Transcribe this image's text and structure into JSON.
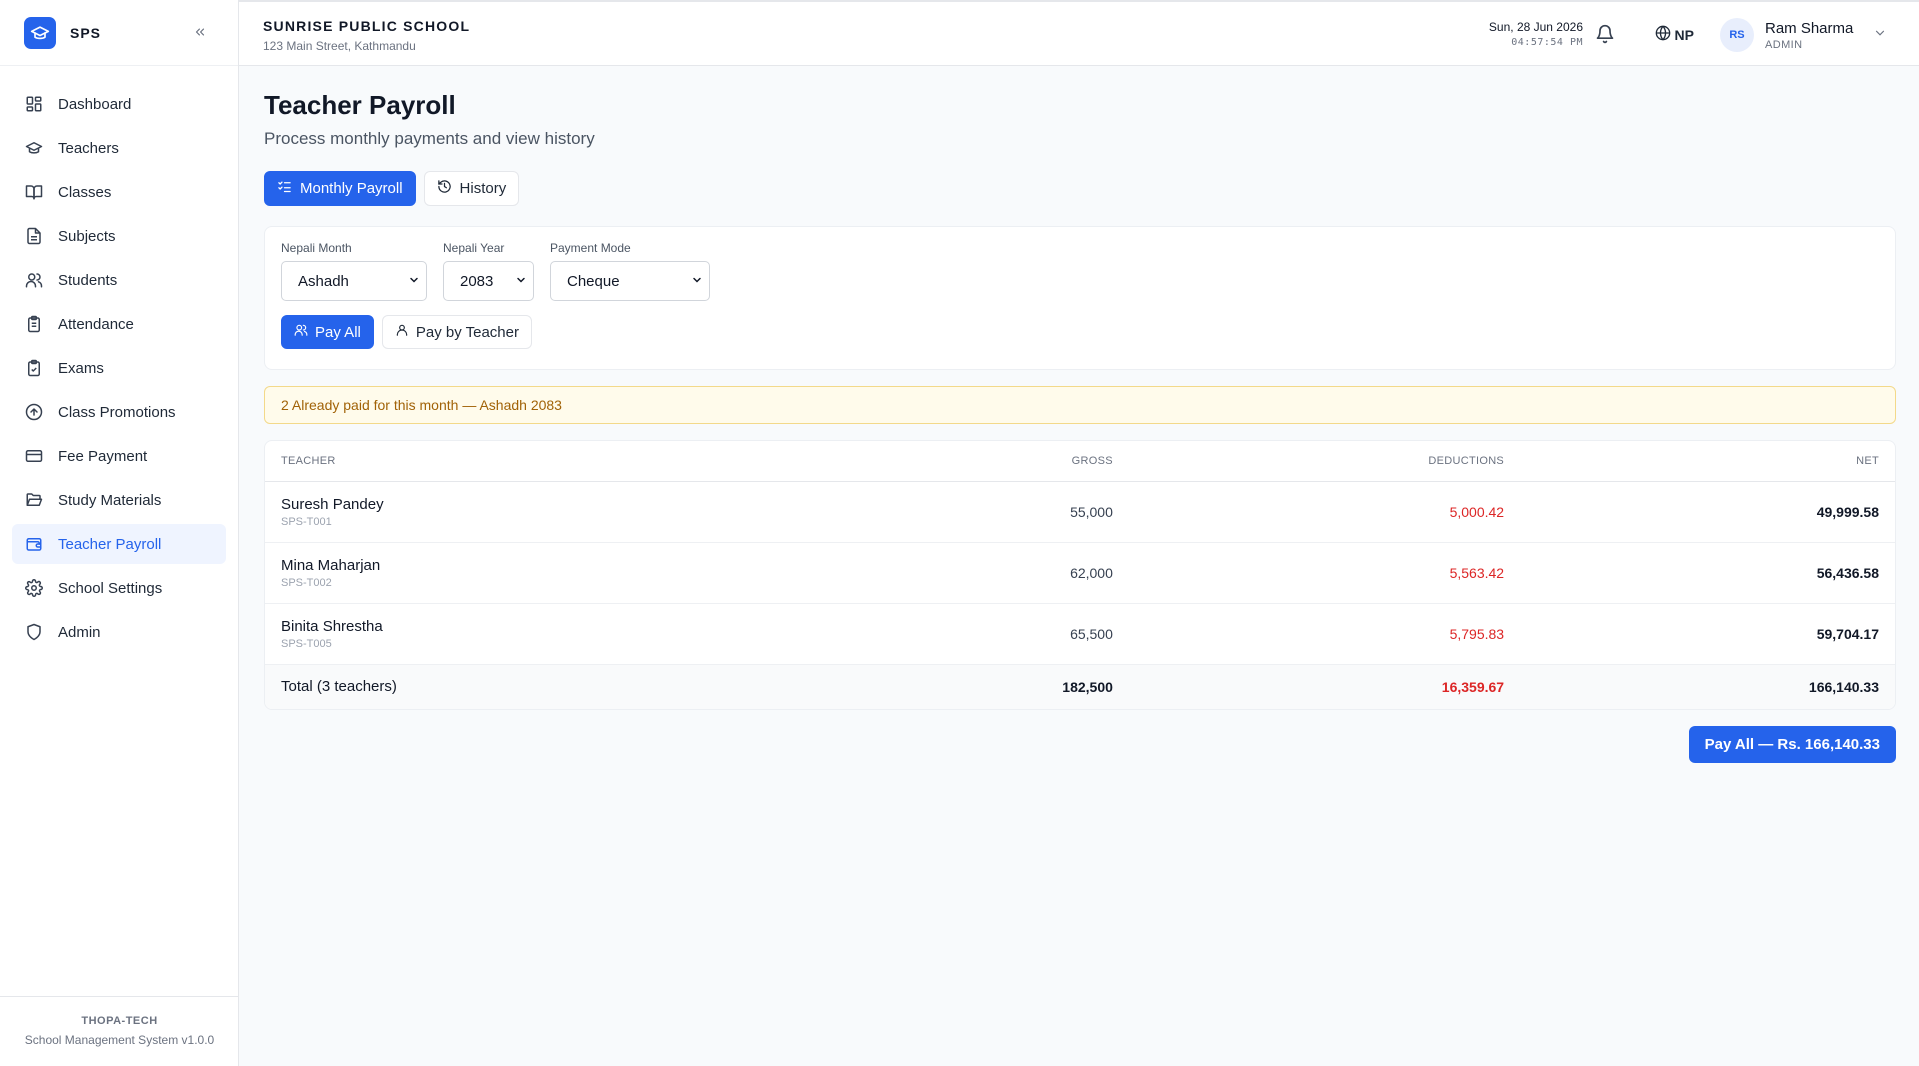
{
  "sidebar": {
    "brand": "SPS",
    "items": [
      {
        "label": "Dashboard",
        "icon": "dashboard-icon"
      },
      {
        "label": "Teachers",
        "icon": "graduation-cap-icon"
      },
      {
        "label": "Classes",
        "icon": "book-open-icon"
      },
      {
        "label": "Subjects",
        "icon": "file-text-icon"
      },
      {
        "label": "Students",
        "icon": "users-icon"
      },
      {
        "label": "Attendance",
        "icon": "clipboard-list-icon"
      },
      {
        "label": "Exams",
        "icon": "clipboard-check-icon"
      },
      {
        "label": "Class Promotions",
        "icon": "arrow-up-circle-icon"
      },
      {
        "label": "Fee Payment",
        "icon": "credit-card-icon"
      },
      {
        "label": "Study Materials",
        "icon": "folder-open-icon"
      },
      {
        "label": "Teacher Payroll",
        "icon": "wallet-icon"
      },
      {
        "label": "School Settings",
        "icon": "gear-icon"
      },
      {
        "label": "Admin",
        "icon": "shield-icon"
      }
    ],
    "active_item": "Teacher Payroll",
    "footer_org": "THOPA-TECH",
    "footer_version": "School Management System v1.0.0"
  },
  "header": {
    "school_name": "SUNRISE PUBLIC SCHOOL",
    "school_address": "123 Main Street, Kathmandu",
    "date": "Sun, 28 Jun 2026",
    "time": "04:57:54 PM",
    "language": "NP",
    "user_initials": "RS",
    "user_name": "Ram Sharma",
    "user_role": "ADMIN"
  },
  "page": {
    "title": "Teacher Payroll",
    "subtitle": "Process monthly payments and view history",
    "tabs": [
      "Monthly Payroll",
      "History"
    ]
  },
  "filters": {
    "month_label": "Nepali Month",
    "month_value": "Ashadh",
    "year_label": "Nepali Year",
    "year_value": "2083",
    "mode_label": "Payment Mode",
    "mode_value": "Cheque",
    "pay_all_label": "Pay All",
    "pay_by_teacher_label": "Pay by Teacher"
  },
  "notice": "2 Already paid for this month — Ashadh 2083",
  "table": {
    "headers": [
      "TEACHER",
      "GROSS",
      "DEDUCTIONS",
      "NET"
    ],
    "rows": [
      {
        "name": "Suresh Pandey",
        "code": "SPS-T001",
        "gross": "55,000",
        "deductions": "5,000.42",
        "net": "49,999.58"
      },
      {
        "name": "Mina Maharjan",
        "code": "SPS-T002",
        "gross": "62,000",
        "deductions": "5,563.42",
        "net": "56,436.58"
      },
      {
        "name": "Binita Shrestha",
        "code": "SPS-T005",
        "gross": "65,500",
        "deductions": "5,795.83",
        "net": "59,704.17"
      }
    ],
    "total": {
      "label": "Total (3 teachers)",
      "gross": "182,500",
      "deductions": "16,359.67",
      "net": "166,140.33"
    }
  },
  "pay_total_button": "Pay All — Rs. 166,140.33",
  "colors": {
    "accent": "#2563eb",
    "deduction": "#dc2626",
    "notice_bg": "#fffbeb",
    "notice_text": "#a16207"
  }
}
